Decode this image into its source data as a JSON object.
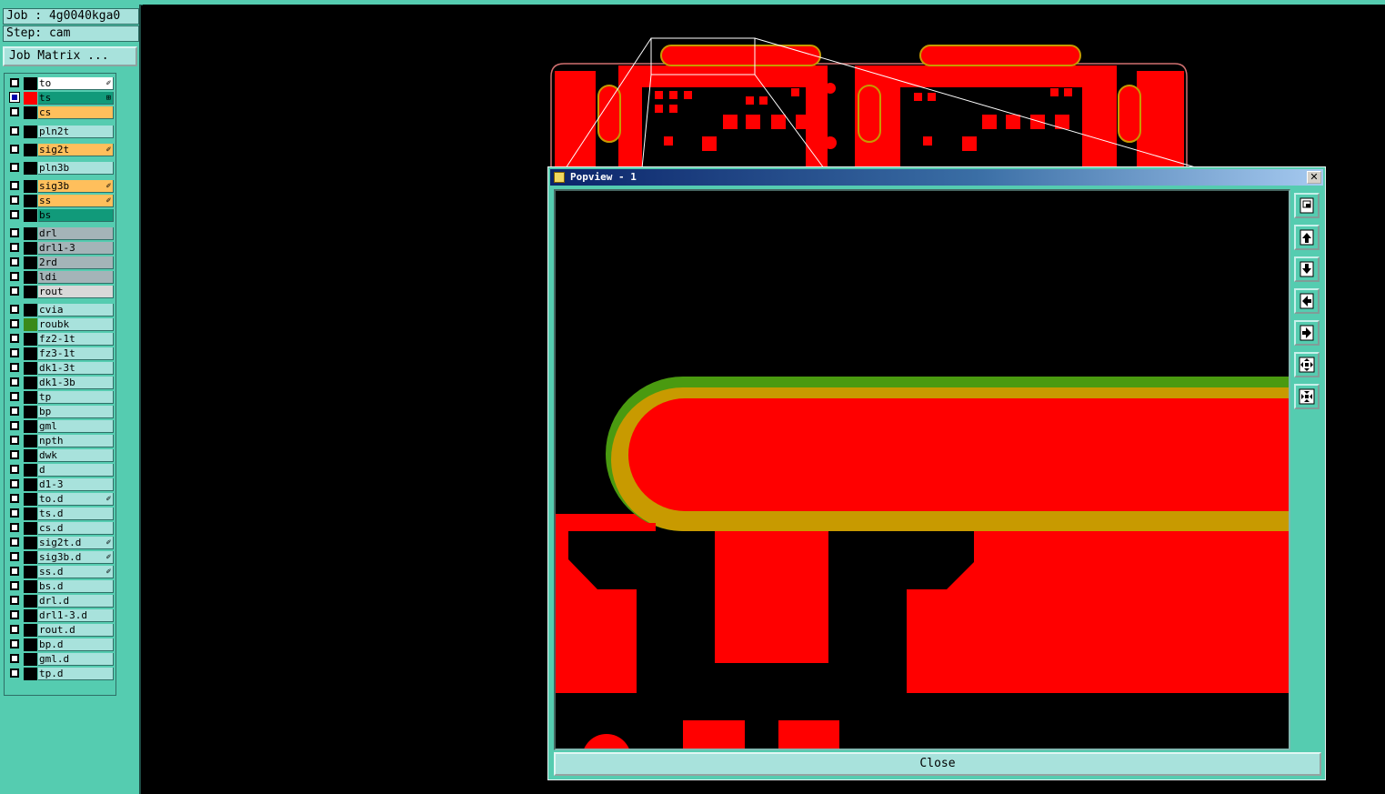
{
  "job_label": "Job : 4g0040kga0",
  "step_label": "Step: cam",
  "job_matrix_button": "Job Matrix ...",
  "layers": [
    {
      "name": "to",
      "bg": "#ffffff",
      "swatch": "",
      "flag": "✐"
    },
    {
      "name": "ts",
      "bg": "#119a7a",
      "swatch": "#ff0000",
      "flag": "⊞",
      "selected": true
    },
    {
      "name": "cs",
      "bg": "#ffbf5c",
      "swatch": "",
      "flag": ""
    },
    {
      "name": "pln2t",
      "bg": "#a8e2dc",
      "swatch": "",
      "flag": ""
    },
    {
      "name": "sig2t",
      "bg": "#ffbf5c",
      "swatch": "",
      "flag": "✐"
    },
    {
      "name": "pln3b",
      "bg": "#a8e2dc",
      "swatch": "",
      "flag": ""
    },
    {
      "name": "sig3b",
      "bg": "#ffbf5c",
      "swatch": "",
      "flag": "✐"
    },
    {
      "name": "ss",
      "bg": "#ffbf5c",
      "swatch": "",
      "flag": "✐"
    },
    {
      "name": "bs",
      "bg": "#119a7a",
      "swatch": "",
      "flag": ""
    },
    {
      "name": "drl",
      "bg": "#a4b4b8",
      "swatch": "",
      "flag": ""
    },
    {
      "name": "drl1-3",
      "bg": "#a4b4b8",
      "swatch": "",
      "flag": ""
    },
    {
      "name": "2rd",
      "bg": "#a4b4b8",
      "swatch": "",
      "flag": ""
    },
    {
      "name": "ldi",
      "bg": "#a4b4b8",
      "swatch": "",
      "flag": ""
    },
    {
      "name": "rout",
      "bg": "#d8d8d8",
      "swatch": "",
      "flag": ""
    },
    {
      "name": "cvia",
      "bg": "#a8e2dc",
      "swatch": "",
      "flag": ""
    },
    {
      "name": "roubk",
      "bg": "#a8e2dc",
      "swatch": "#3a8a1a",
      "flag": ""
    },
    {
      "name": "fz2-1t",
      "bg": "#a8e2dc",
      "swatch": "",
      "flag": ""
    },
    {
      "name": "fz3-1t",
      "bg": "#a8e2dc",
      "swatch": "",
      "flag": ""
    },
    {
      "name": "dk1-3t",
      "bg": "#a8e2dc",
      "swatch": "",
      "flag": ""
    },
    {
      "name": "dk1-3b",
      "bg": "#a8e2dc",
      "swatch": "",
      "flag": ""
    },
    {
      "name": "tp",
      "bg": "#a8e2dc",
      "swatch": "",
      "flag": ""
    },
    {
      "name": "bp",
      "bg": "#a8e2dc",
      "swatch": "",
      "flag": ""
    },
    {
      "name": "gml",
      "bg": "#a8e2dc",
      "swatch": "",
      "flag": ""
    },
    {
      "name": "npth",
      "bg": "#a8e2dc",
      "swatch": "",
      "flag": ""
    },
    {
      "name": "dwk",
      "bg": "#a8e2dc",
      "swatch": "",
      "flag": ""
    },
    {
      "name": "d",
      "bg": "#a8e2dc",
      "swatch": "",
      "flag": ""
    },
    {
      "name": "d1-3",
      "bg": "#a8e2dc",
      "swatch": "",
      "flag": ""
    },
    {
      "name": "to.d",
      "bg": "#a8e2dc",
      "swatch": "",
      "flag": "✐"
    },
    {
      "name": "ts.d",
      "bg": "#a8e2dc",
      "swatch": "",
      "flag": ""
    },
    {
      "name": "cs.d",
      "bg": "#a8e2dc",
      "swatch": "",
      "flag": ""
    },
    {
      "name": "sig2t.d",
      "bg": "#a8e2dc",
      "swatch": "",
      "flag": "✐"
    },
    {
      "name": "sig3b.d",
      "bg": "#a8e2dc",
      "swatch": "",
      "flag": "✐"
    },
    {
      "name": "ss.d",
      "bg": "#a8e2dc",
      "swatch": "",
      "flag": "✐"
    },
    {
      "name": "bs.d",
      "bg": "#a8e2dc",
      "swatch": "",
      "flag": ""
    },
    {
      "name": "drl.d",
      "bg": "#a8e2dc",
      "swatch": "",
      "flag": ""
    },
    {
      "name": "drl1-3.d",
      "bg": "#a8e2dc",
      "swatch": "",
      "flag": ""
    },
    {
      "name": "rout.d",
      "bg": "#a8e2dc",
      "swatch": "",
      "flag": ""
    },
    {
      "name": "bp.d",
      "bg": "#a8e2dc",
      "swatch": "",
      "flag": ""
    },
    {
      "name": "gml.d",
      "bg": "#a8e2dc",
      "swatch": "",
      "flag": ""
    },
    {
      "name": "tp.d",
      "bg": "#a8e2dc",
      "swatch": "",
      "flag": ""
    }
  ],
  "popview": {
    "title": "Popview - 1",
    "close_label": "Close",
    "tool_icons": [
      "zoom-window-icon",
      "pan-up-icon",
      "pan-down-icon",
      "pan-left-icon",
      "pan-right-icon",
      "zoom-out-icon",
      "zoom-in-icon"
    ]
  },
  "colors": {
    "copper": "#ff0000",
    "mask": "#c89a00",
    "rout": "#4a9a10",
    "panel": "#55ccb0",
    "field": "#a8e2dc"
  }
}
